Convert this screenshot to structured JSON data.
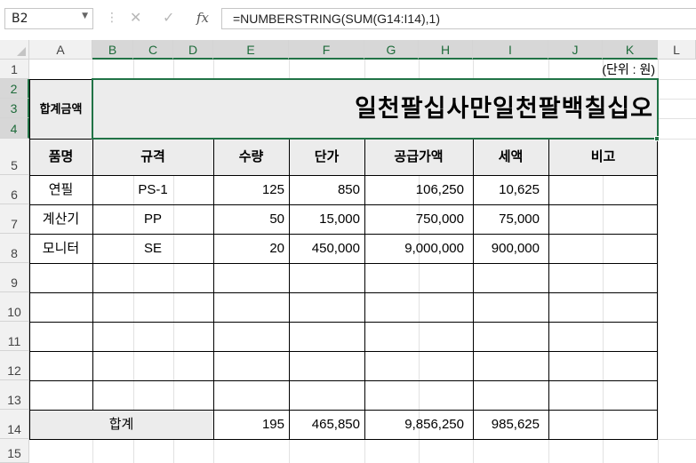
{
  "formula_bar": {
    "name_box": "B2",
    "cancel_icon": "✕",
    "enter_icon": "✓",
    "fx_label": "fx",
    "formula": "=NUMBERSTRING(SUM(G14:I14),1)"
  },
  "columns": [
    "A",
    "B",
    "C",
    "D",
    "E",
    "F",
    "G",
    "H",
    "I",
    "J",
    "K",
    "L"
  ],
  "rows": [
    "1",
    "2",
    "3",
    "4",
    "5",
    "6",
    "7",
    "8",
    "9",
    "10",
    "11",
    "12",
    "13",
    "14",
    "15"
  ],
  "selected_cell": "B2",
  "unit_note": "(단위 : 원)",
  "total_label": "합계금액",
  "total_text": "일천팔십사만일천팔백칠십오",
  "table": {
    "headers": [
      "품명",
      "규격",
      "수량",
      "단가",
      "공급가액",
      "세액",
      "비고"
    ],
    "items": [
      {
        "name": "연필",
        "spec": "PS-1",
        "qty": "125",
        "price": "850",
        "supply": "106,250",
        "tax": "10,625",
        "note": ""
      },
      {
        "name": "계산기",
        "spec": "PP",
        "qty": "50",
        "price": "15,000",
        "supply": "750,000",
        "tax": "75,000",
        "note": ""
      },
      {
        "name": "모니터",
        "spec": "SE",
        "qty": "20",
        "price": "450,000",
        "supply": "9,000,000",
        "tax": "900,000",
        "note": ""
      }
    ],
    "sum_row": {
      "label": "합계",
      "qty": "195",
      "price": "465,850",
      "supply": "9,856,250",
      "tax": "985,625"
    }
  },
  "colors": {
    "accent": "#217346",
    "header_gray": "#ececec"
  }
}
